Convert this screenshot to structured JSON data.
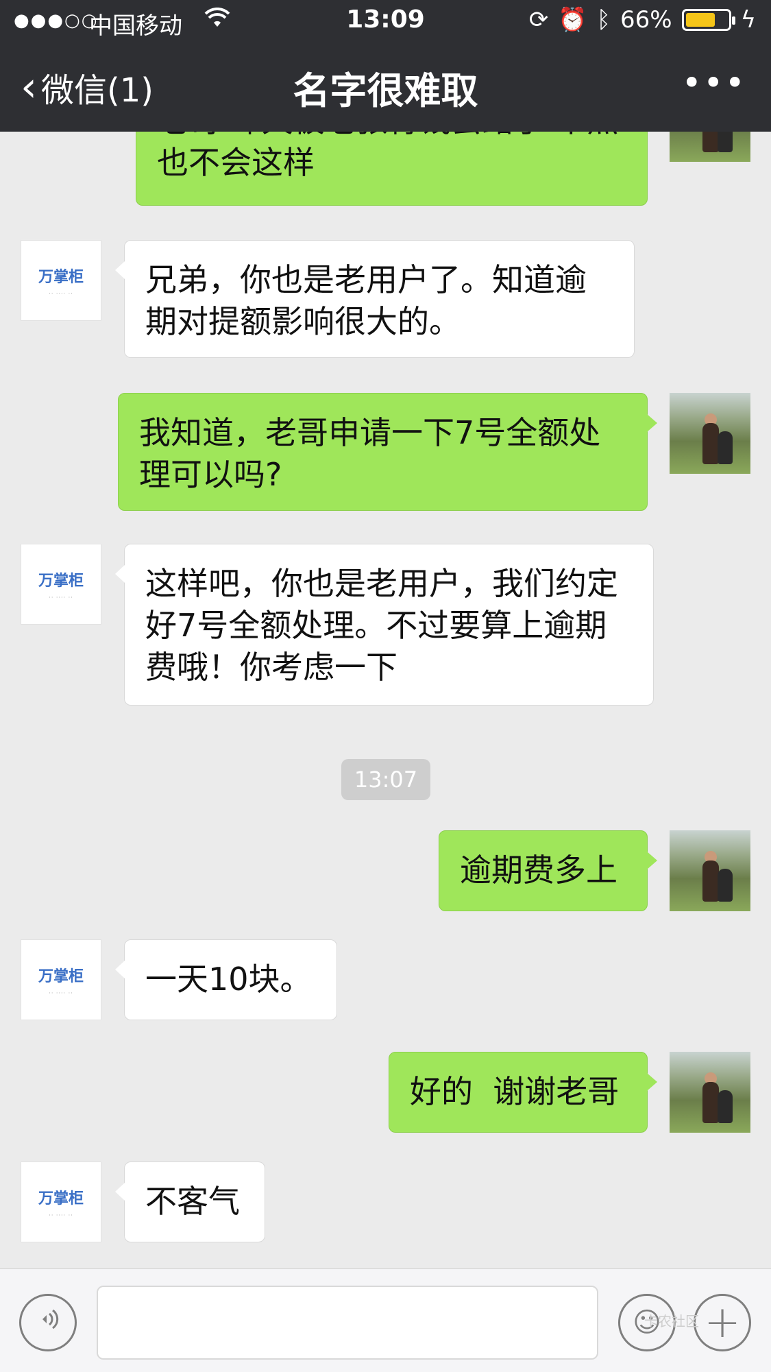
{
  "status_bar": {
    "signal": "●●●○○",
    "carrier": "中国移动",
    "time": "13:09",
    "battery": "66%"
  },
  "nav": {
    "back_label": "微信(1)",
    "title": "名字很难取",
    "more": "•••"
  },
  "messages": [
    {
      "side": "out",
      "text": "老哥 昨天被老张骨钱尝路了 不然也不会这样"
    },
    {
      "side": "in",
      "avatar_text": "万掌柜",
      "text": "兄弟，你也是老用户了。知道逾期对提额影响很大的。"
    },
    {
      "side": "out",
      "text": "我知道，老哥申请一下7号全额处理可以吗?"
    },
    {
      "side": "in",
      "avatar_text": "万掌柜",
      "text": "这样吧，你也是老用户，我们约定好7号全额处理。不过要算上逾期费哦！你考虑一下"
    },
    {
      "side": "time",
      "text": "13:07"
    },
    {
      "side": "out",
      "text": "逾期费多上"
    },
    {
      "side": "in",
      "avatar_text": "万掌柜",
      "text": "一天10块。"
    },
    {
      "side": "out",
      "text": "好的  谢谢老哥"
    },
    {
      "side": "in",
      "avatar_text": "万掌柜",
      "text": "不客气"
    }
  ],
  "input_bar": {
    "watermark": "卡农社区"
  }
}
